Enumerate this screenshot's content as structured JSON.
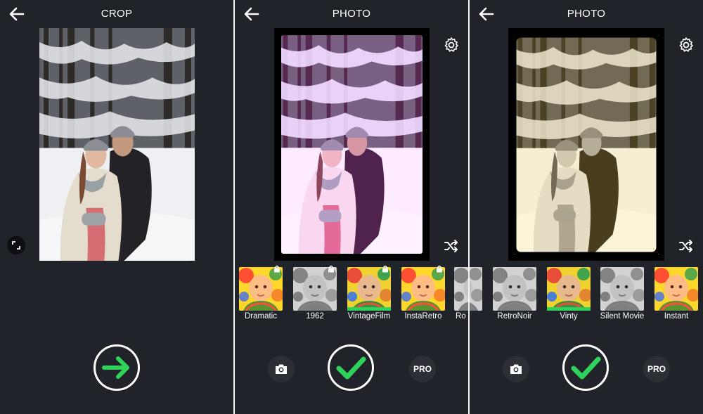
{
  "screens": [
    {
      "title": "CROP"
    },
    {
      "title": "PHOTO",
      "filters": [
        {
          "label": "Dramatic",
          "locked": true,
          "selected": false
        },
        {
          "label": "1962",
          "locked": true,
          "selected": false
        },
        {
          "label": "VintageFilm",
          "locked": true,
          "selected": true
        },
        {
          "label": "InstaRetro",
          "locked": true,
          "selected": false
        },
        {
          "label": "Ro",
          "locked": false,
          "selected": false
        }
      ],
      "pro_label": "PRO"
    },
    {
      "title": "PHOTO",
      "filters": [
        {
          "label": "RetroNoir",
          "locked": false,
          "selected": false
        },
        {
          "label": "Vinty",
          "locked": false,
          "selected": true
        },
        {
          "label": "Silent Movie",
          "locked": false,
          "selected": false
        },
        {
          "label": "Instant",
          "locked": false,
          "selected": false
        }
      ],
      "pro_label": "PRO"
    }
  ],
  "colors": {
    "accent": "#2fd35b",
    "background": "#21232a"
  },
  "icons": [
    "back-arrow-icon",
    "gear-icon",
    "shuffle-icon",
    "expand-icon",
    "camera-icon",
    "checkmark-icon",
    "arrow-right-icon",
    "lock-icon"
  ]
}
